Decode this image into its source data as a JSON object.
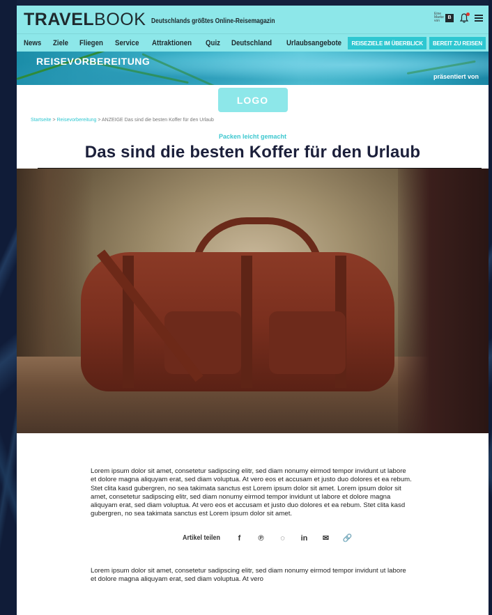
{
  "header": {
    "logo_bold": "TRAVEL",
    "logo_light": "BOOK",
    "tagline": "Deutschlands größtes Online-Reisemagazin",
    "bild_small": "Eine Marke von",
    "bild_logo": "Bild",
    "icons": [
      "bild-logo-icon",
      "bell-icon",
      "menu-icon"
    ],
    "notification_color": "#e2332b"
  },
  "nav": {
    "items": [
      "News",
      "Ziele",
      "Fliegen",
      "Service",
      "Attraktionen",
      "Quiz",
      "Deutschland",
      "Urlaubsangebote"
    ],
    "buttons": [
      "REISEZIELE IM ÜBERBLICK",
      "BEREIT ZU REISEN"
    ]
  },
  "banner": {
    "title": "REISEVORBEREITUNG",
    "presented_by": "präsentiert von"
  },
  "sponsor": {
    "logo_text": "LOGO"
  },
  "breadcrumb": {
    "home": "Startseite",
    "separator": " > ",
    "section": "Reisevorbereitung",
    "current": "ANZEIGE Das sind die besten Koffer für den Urlaub"
  },
  "article": {
    "kicker": "Packen leicht gemacht",
    "title": "Das sind die besten Koffer für den Urlaub",
    "paragraph1": "Lorem ipsum dolor sit amet, consetetur sadipscing elitr, sed diam nonumy eirmod tempor invidunt ut labore et dolore magna aliquyam erat, sed diam voluptua. At vero eos et accusam et justo duo dolores et ea rebum. Stet clita kasd gubergren, no sea takimata sanctus est Lorem ipsum dolor sit amet. Lorem ipsum dolor sit amet, consetetur sadipscing elitr, sed diam nonumy eirmod tempor invidunt ut labore et dolore magna aliquyam erat, sed diam voluptua. At vero eos et accusam et justo duo dolores et ea rebum. Stet clita kasd gubergren, no sea takimata sanctus est Lorem ipsum dolor sit amet.",
    "paragraph2": "Lorem ipsum dolor sit amet, consetetur sadipscing elitr, sed diam nonumy eirmod tempor invidunt ut labore et dolore magna aliquyam erat, sed diam voluptua. At vero"
  },
  "share": {
    "label": "Artikel teilen",
    "icons": [
      {
        "name": "facebook-icon",
        "glyph": "f"
      },
      {
        "name": "pinterest-icon",
        "glyph": "℗"
      },
      {
        "name": "whatsapp-icon",
        "glyph": "◌"
      },
      {
        "name": "linkedin-icon",
        "glyph": "in"
      },
      {
        "name": "email-icon",
        "glyph": "✉"
      },
      {
        "name": "link-icon",
        "glyph": "🔗"
      }
    ]
  },
  "colors": {
    "brand_turquoise": "#8de7e9",
    "button_turquoise": "#2ec7d1",
    "headline": "#1b1f3a"
  }
}
